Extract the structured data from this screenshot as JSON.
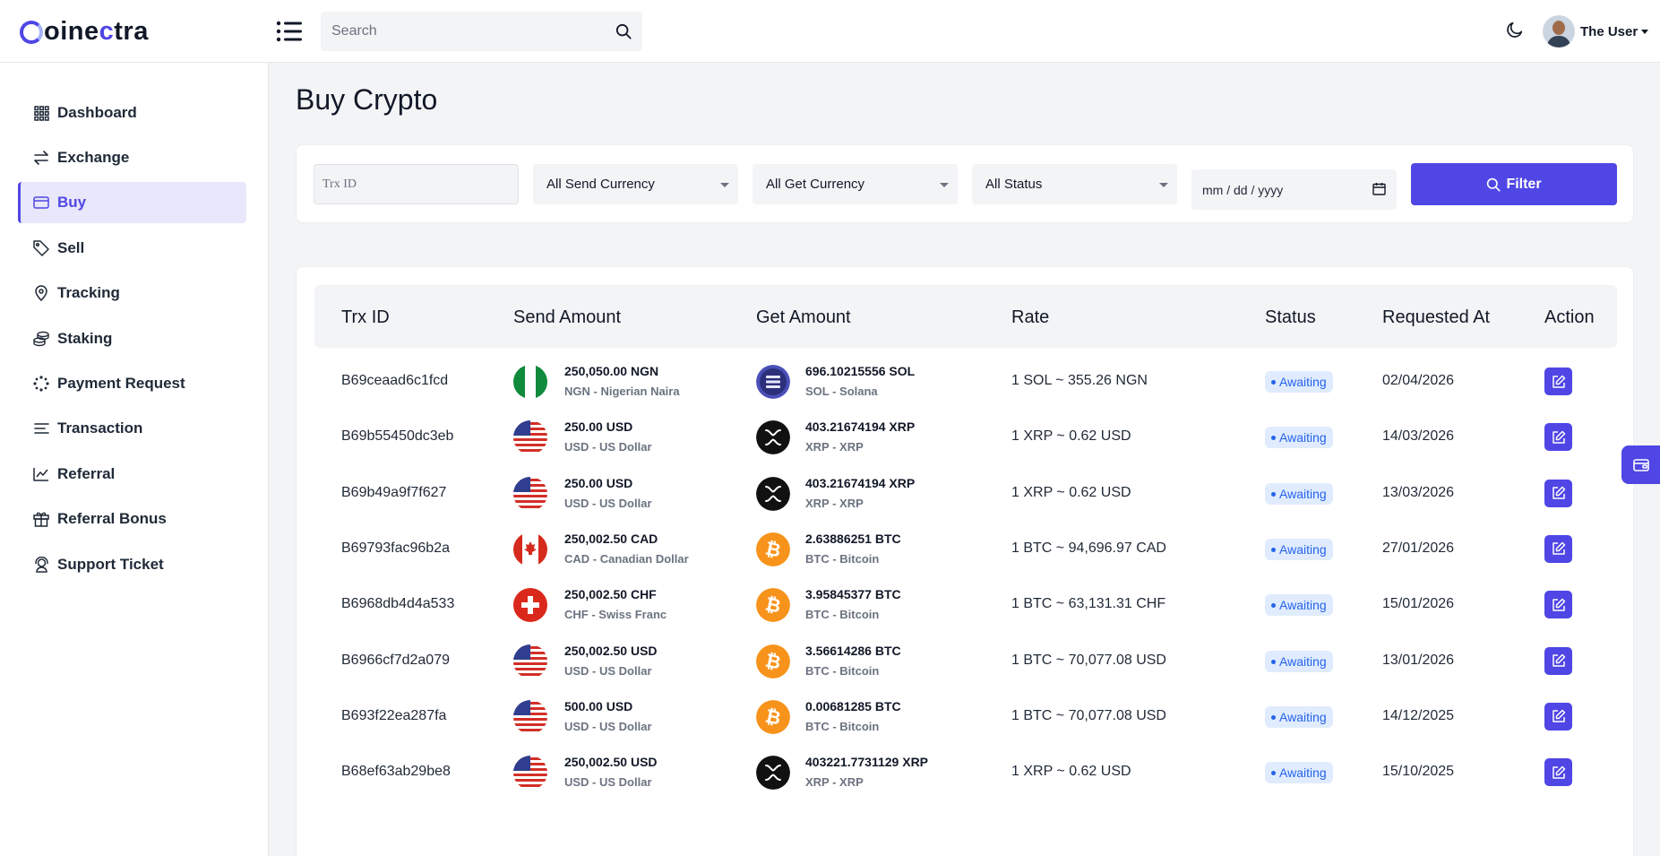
{
  "brand": {
    "prefix": "oine",
    "accent": "c",
    "suffix": "tra",
    "accent_color": "#4f46e5"
  },
  "header": {
    "search_placeholder": "Search",
    "user_name": "The User"
  },
  "sidebar": {
    "items": [
      {
        "label": "Dashboard",
        "icon": "grid-icon"
      },
      {
        "label": "Exchange",
        "icon": "exchange-icon"
      },
      {
        "label": "Buy",
        "icon": "wallet-icon",
        "active": true
      },
      {
        "label": "Sell",
        "icon": "tag-icon"
      },
      {
        "label": "Tracking",
        "icon": "map-pin-icon"
      },
      {
        "label": "Staking",
        "icon": "coins-icon"
      },
      {
        "label": "Payment Request",
        "icon": "loader-icon"
      },
      {
        "label": "Transaction",
        "icon": "list-icon"
      },
      {
        "label": "Referral",
        "icon": "chart-line-icon"
      },
      {
        "label": "Referral Bonus",
        "icon": "gift-icon"
      },
      {
        "label": "Support Ticket",
        "icon": "support-icon"
      }
    ]
  },
  "page": {
    "title": "Buy Crypto"
  },
  "filters": {
    "trx_placeholder": "Trx ID",
    "send_currency": "All Send Currency",
    "get_currency": "All Get Currency",
    "status": "All Status",
    "date_placeholder": "mm / dd / yyyy",
    "button": "Filter"
  },
  "table": {
    "headers": {
      "trx": "Trx ID",
      "send": "Send Amount",
      "get": "Get Amount",
      "rate": "Rate",
      "status": "Status",
      "requested": "Requested At",
      "action": "Action"
    },
    "rows": [
      {
        "trx": "B69ceaad6c1fcd",
        "send_flag": "ng",
        "send_amount": "250,050.00 NGN",
        "send_name": "NGN - Nigerian Naira",
        "get_coin": "sol",
        "get_amount": "696.10215556 SOL",
        "get_name": "SOL - Solana",
        "rate": "1 SOL ~ 355.26 NGN",
        "status": "Awaiting",
        "date": "02/04/2026"
      },
      {
        "trx": "B69b55450dc3eb",
        "send_flag": "us",
        "send_amount": "250.00 USD",
        "send_name": "USD - US Dollar",
        "get_coin": "xrp",
        "get_amount": "403.21674194 XRP",
        "get_name": "XRP - XRP",
        "rate": "1 XRP ~ 0.62 USD",
        "status": "Awaiting",
        "date": "14/03/2026"
      },
      {
        "trx": "B69b49a9f7f627",
        "send_flag": "us",
        "send_amount": "250.00 USD",
        "send_name": "USD - US Dollar",
        "get_coin": "xrp",
        "get_amount": "403.21674194 XRP",
        "get_name": "XRP - XRP",
        "rate": "1 XRP ~ 0.62 USD",
        "status": "Awaiting",
        "date": "13/03/2026"
      },
      {
        "trx": "B69793fac96b2a",
        "send_flag": "ca",
        "send_amount": "250,002.50 CAD",
        "send_name": "CAD - Canadian Dollar",
        "get_coin": "btc",
        "get_amount": "2.63886251 BTC",
        "get_name": "BTC - Bitcoin",
        "rate": "1 BTC ~ 94,696.97 CAD",
        "status": "Awaiting",
        "date": "27/01/2026"
      },
      {
        "trx": "B6968db4d4a533",
        "send_flag": "ch",
        "send_amount": "250,002.50 CHF",
        "send_name": "CHF - Swiss Franc",
        "get_coin": "btc",
        "get_amount": "3.95845377 BTC",
        "get_name": "BTC - Bitcoin",
        "rate": "1 BTC ~ 63,131.31 CHF",
        "status": "Awaiting",
        "date": "15/01/2026"
      },
      {
        "trx": "B6966cf7d2a079",
        "send_flag": "us",
        "send_amount": "250,002.50 USD",
        "send_name": "USD - US Dollar",
        "get_coin": "btc",
        "get_amount": "3.56614286 BTC",
        "get_name": "BTC - Bitcoin",
        "rate": "1 BTC ~ 70,077.08 USD",
        "status": "Awaiting",
        "date": "13/01/2026"
      },
      {
        "trx": "B693f22ea287fa",
        "send_flag": "us",
        "send_amount": "500.00 USD",
        "send_name": "USD - US Dollar",
        "get_coin": "btc",
        "get_amount": "0.00681285 BTC",
        "get_name": "BTC - Bitcoin",
        "rate": "1 BTC ~ 70,077.08 USD",
        "status": "Awaiting",
        "date": "14/12/2025"
      },
      {
        "trx": "B68ef63ab29be8",
        "send_flag": "us",
        "send_amount": "250,002.50 USD",
        "send_name": "USD - US Dollar",
        "get_coin": "xrp",
        "get_amount": "403221.7731129 XRP",
        "get_name": "XRP - XRP",
        "rate": "1 XRP ~ 0.62 USD",
        "status": "Awaiting",
        "date": "15/10/2025"
      }
    ]
  },
  "colors": {
    "primary": "#4f46e5",
    "badge_bg": "#e0ecfd",
    "badge_text": "#2563eb"
  }
}
